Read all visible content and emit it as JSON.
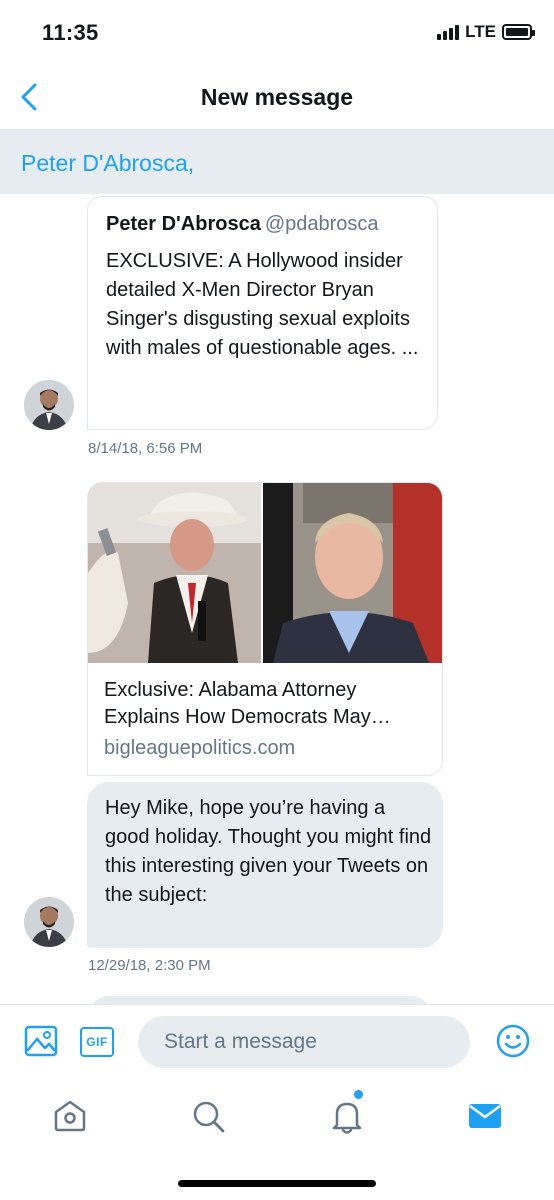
{
  "status_bar": {
    "time": "11:35",
    "network": "LTE"
  },
  "nav": {
    "title": "New message",
    "back_icon": "chevron-left-icon"
  },
  "recipient": {
    "text": "Peter D'Abrosca,"
  },
  "conversation": {
    "tweet_card": {
      "author_name": "Peter D'Abrosca",
      "author_handle": "@pdabrosca",
      "text": "EXCLUSIVE: A Hollywood insider detailed X-Men Director Bryan Singer's disgusting sexual exploits with males of questionable ages. ..."
    },
    "timestamp_1": "8/14/18, 6:56 PM",
    "link_card": {
      "title": "Exclusive: Alabama Attorney Explains How Democrats May…",
      "domain": "bigleaguepolitics.com"
    },
    "message": {
      "text": "Hey Mike, hope you’re having a good holiday. Thought you might find this interesting given your Tweets on the subject:"
    },
    "timestamp_2": "12/29/18, 2:30 PM"
  },
  "composer": {
    "placeholder": "Start a message",
    "gif_label": "GIF",
    "media_icon": "image-icon",
    "emoji_icon": "emoji-icon"
  },
  "tabbar": {
    "items": [
      "home-icon",
      "search-icon",
      "notifications-icon",
      "messages-icon"
    ],
    "active": "messages-icon",
    "notification_dot": true
  },
  "colors": {
    "accent": "#1da1f2",
    "bubble_bg": "#e6ecf0",
    "muted_text": "#657786",
    "text": "#14171a"
  }
}
